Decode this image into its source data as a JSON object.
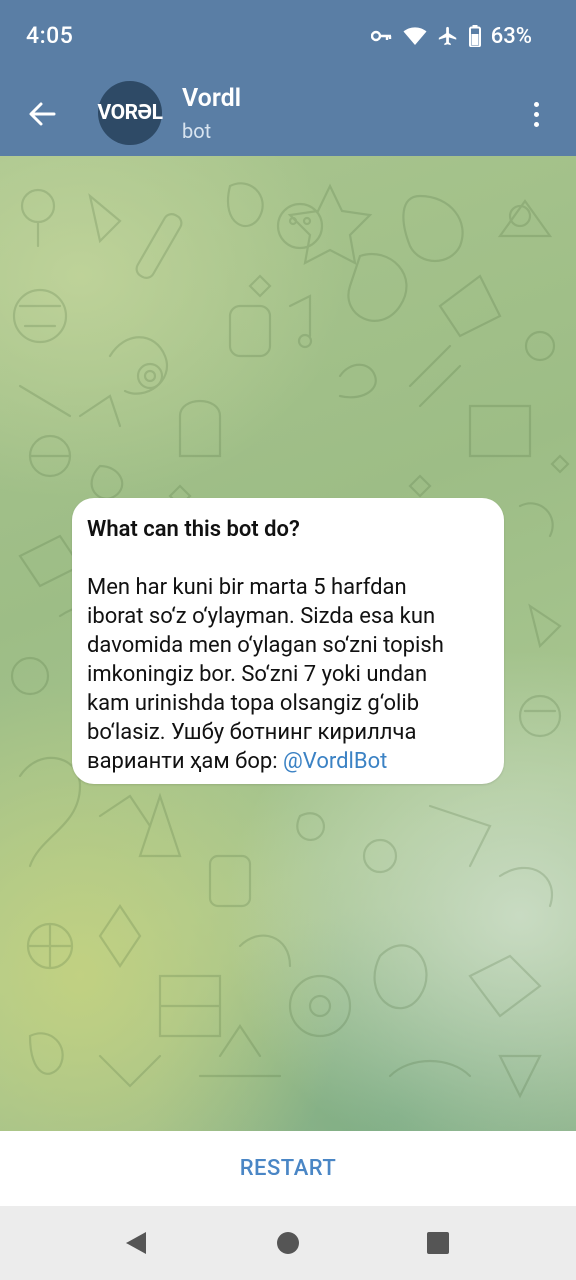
{
  "status_bar": {
    "time": "4:05",
    "battery": "63%",
    "icons": [
      "key-icon",
      "wifi-icon",
      "airplane-icon",
      "battery-icon"
    ]
  },
  "header": {
    "back_icon": "arrow-left-icon",
    "avatar_text": "VORƏL",
    "title": "Vordl",
    "subtitle": "bot",
    "menu_icon": "more-vert-icon"
  },
  "card": {
    "title": "What can this bot do?",
    "body": "Men har kuni bir marta 5 harfdan\niborat so‘z o‘ylayman. Sizda esa kun\ndavomida men o‘ylagan so‘zni topish\nimkoningiz bor. So‘zni 7 yoki undan\nkam urinishda topa olsangiz g‘olib\nbo‘lasiz. Ушбу ботнинг кириллча\nварианти ҳам бор: ",
    "link": "@VordlBot"
  },
  "bottom": {
    "restart_label": "RESTART"
  },
  "colors": {
    "header_bg": "#5a7ea5",
    "link": "#3b82c4",
    "restart": "#4a86c5"
  }
}
